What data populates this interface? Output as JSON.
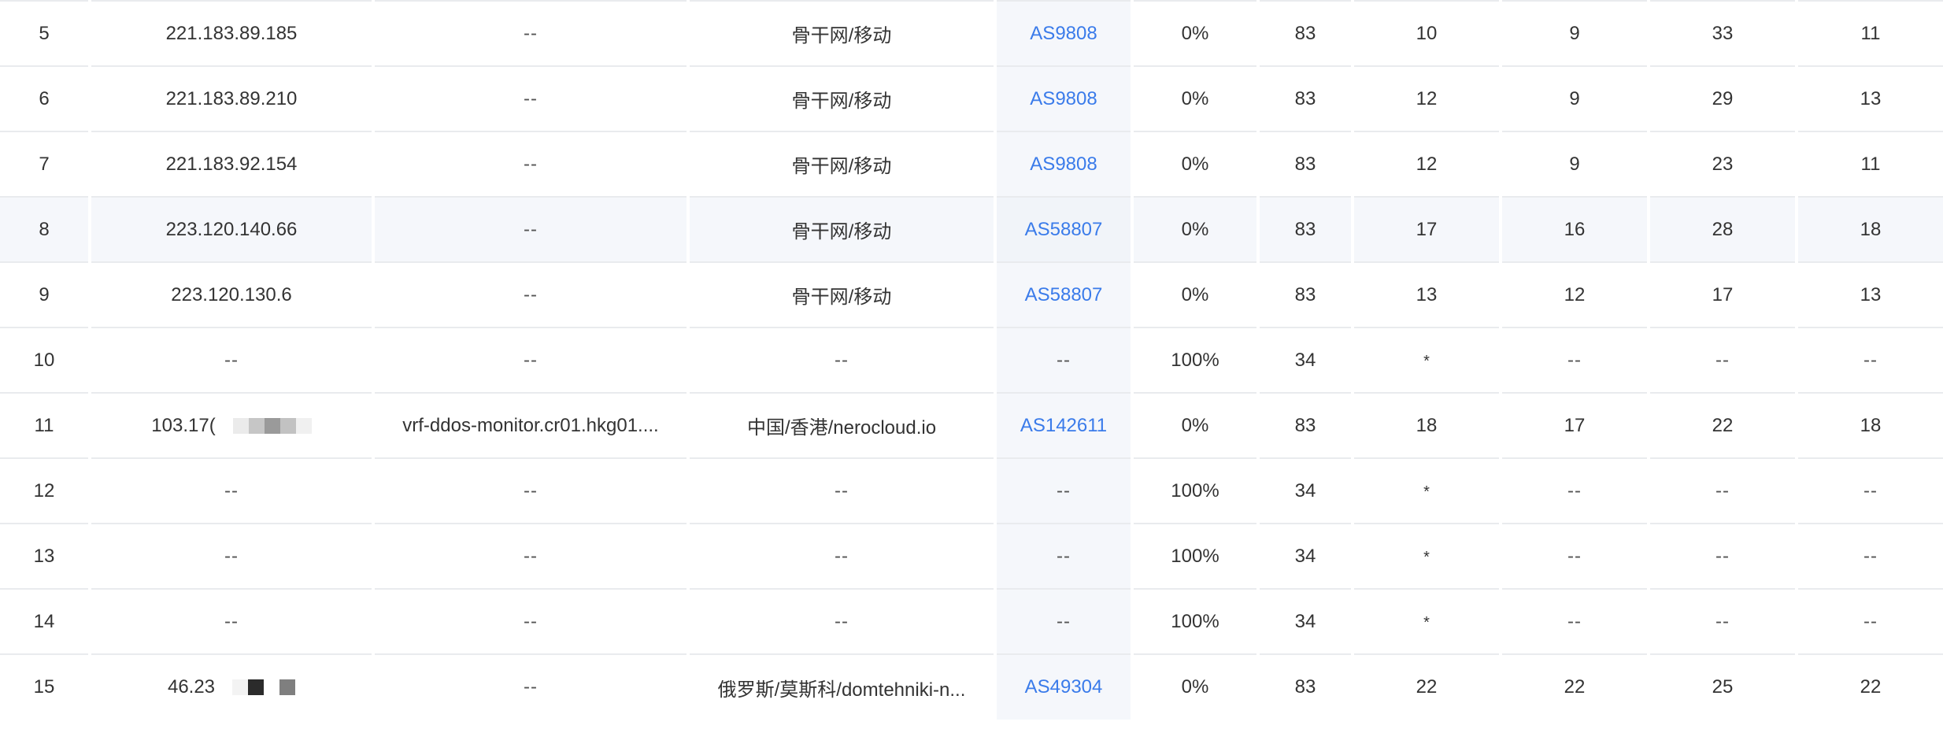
{
  "colors": {
    "link": "#3a7bea",
    "row_highlight": "#f5f7fb",
    "border": "#e9ebee"
  },
  "rows": [
    {
      "hop": "5",
      "ip": "221.183.89.185",
      "host": "--",
      "location": "骨干网/移动",
      "asn": "AS9808",
      "loss": "0%",
      "sent": "83",
      "last": "10",
      "best": "9",
      "worst": "33",
      "avg": "11"
    },
    {
      "hop": "6",
      "ip": "221.183.89.210",
      "host": "--",
      "location": "骨干网/移动",
      "asn": "AS9808",
      "loss": "0%",
      "sent": "83",
      "last": "12",
      "best": "9",
      "worst": "29",
      "avg": "13"
    },
    {
      "hop": "7",
      "ip": "221.183.92.154",
      "host": "--",
      "location": "骨干网/移动",
      "asn": "AS9808",
      "loss": "0%",
      "sent": "83",
      "last": "12",
      "best": "9",
      "worst": "23",
      "avg": "11"
    },
    {
      "hop": "8",
      "ip": "223.120.140.66",
      "host": "--",
      "location": "骨干网/移动",
      "asn": "AS58807",
      "loss": "0%",
      "sent": "83",
      "last": "17",
      "best": "16",
      "worst": "28",
      "avg": "18"
    },
    {
      "hop": "9",
      "ip": "223.120.130.6",
      "host": "--",
      "location": "骨干网/移动",
      "asn": "AS58807",
      "loss": "0%",
      "sent": "83",
      "last": "13",
      "best": "12",
      "worst": "17",
      "avg": "13"
    },
    {
      "hop": "10",
      "ip": "--",
      "host": "--",
      "location": "--",
      "asn": "--",
      "loss": "100%",
      "sent": "34",
      "last": "*",
      "best": "--",
      "worst": "--",
      "avg": "--"
    },
    {
      "hop": "11",
      "ip": "103.17(",
      "host": "vrf-ddos-monitor.cr01.hkg01....",
      "location": "中国/香港/nerocloud.io",
      "asn": "AS142611",
      "loss": "0%",
      "sent": "83",
      "last": "18",
      "best": "17",
      "worst": "22",
      "avg": "18"
    },
    {
      "hop": "12",
      "ip": "--",
      "host": "--",
      "location": "--",
      "asn": "--",
      "loss": "100%",
      "sent": "34",
      "last": "*",
      "best": "--",
      "worst": "--",
      "avg": "--"
    },
    {
      "hop": "13",
      "ip": "--",
      "host": "--",
      "location": "--",
      "asn": "--",
      "loss": "100%",
      "sent": "34",
      "last": "*",
      "best": "--",
      "worst": "--",
      "avg": "--"
    },
    {
      "hop": "14",
      "ip": "--",
      "host": "--",
      "location": "--",
      "asn": "--",
      "loss": "100%",
      "sent": "34",
      "last": "*",
      "best": "--",
      "worst": "--",
      "avg": "--"
    },
    {
      "hop": "15",
      "ip": "46.23",
      "host": "--",
      "location": "俄罗斯/莫斯科/domtehniki-n...",
      "asn": "AS49304",
      "loss": "0%",
      "sent": "83",
      "last": "22",
      "best": "22",
      "worst": "25",
      "avg": "22"
    }
  ]
}
